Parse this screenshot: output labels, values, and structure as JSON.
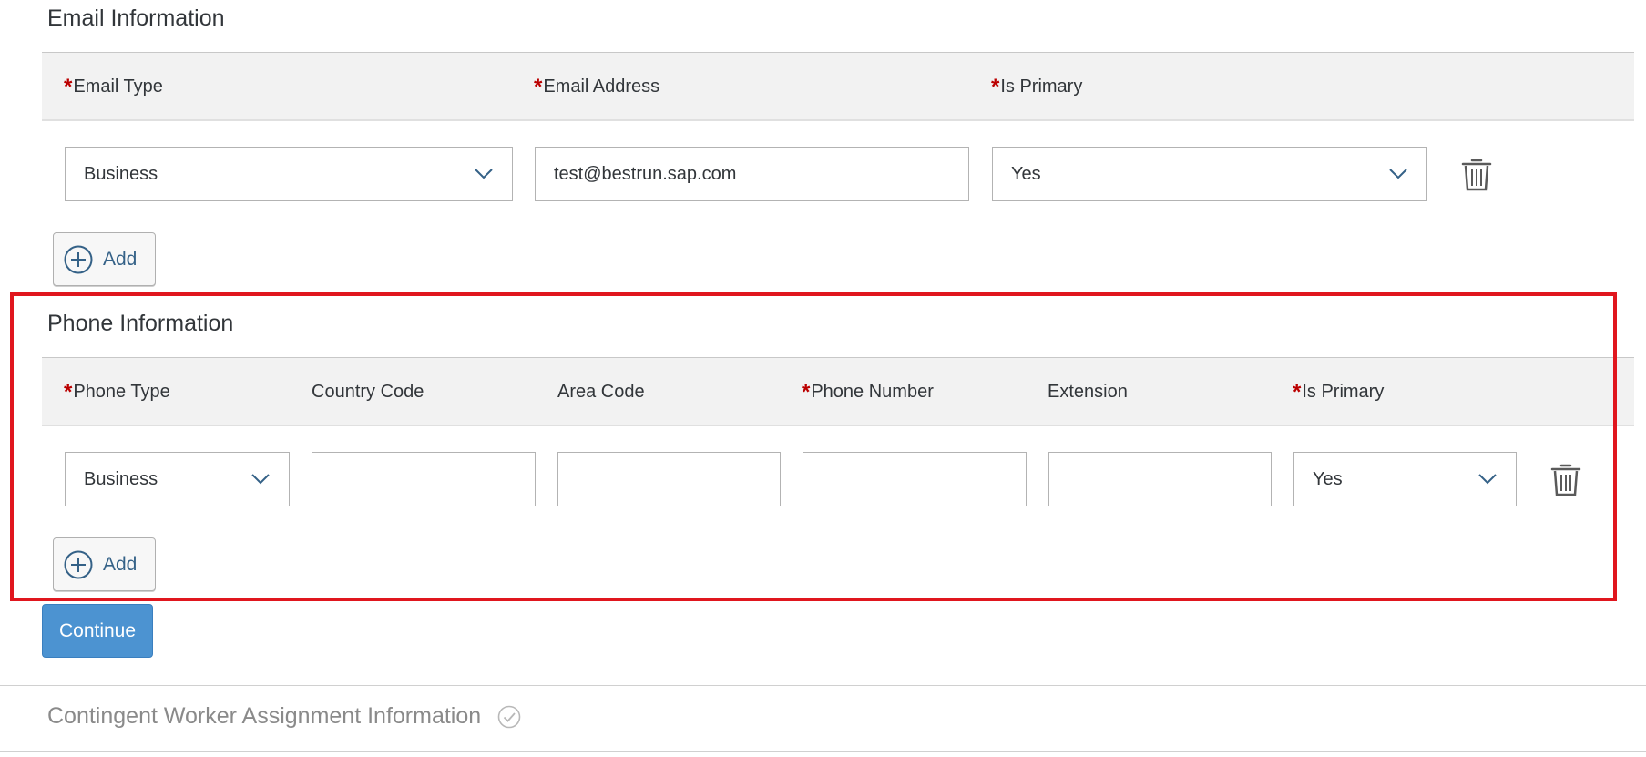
{
  "email_section": {
    "title": "Email Information",
    "columns": [
      {
        "label": "Email Type",
        "required": true
      },
      {
        "label": "Email Address",
        "required": true
      },
      {
        "label": "Is Primary",
        "required": true
      }
    ],
    "row": {
      "email_type": "Business",
      "email_address": "test@bestrun.sap.com",
      "is_primary": "Yes"
    },
    "add_label": "Add"
  },
  "phone_section": {
    "title": "Phone Information",
    "columns": [
      {
        "label": "Phone Type",
        "required": true
      },
      {
        "label": "Country Code",
        "required": false
      },
      {
        "label": "Area Code",
        "required": false
      },
      {
        "label": "Phone Number",
        "required": true
      },
      {
        "label": "Extension",
        "required": false
      },
      {
        "label": "Is Primary",
        "required": true
      }
    ],
    "row": {
      "phone_type": "Business",
      "country_code": "",
      "area_code": "",
      "phone_number": "",
      "extension": "",
      "is_primary": "Yes"
    },
    "add_label": "Add"
  },
  "continue_label": "Continue",
  "next_section": {
    "title": "Contingent Worker Assignment Information",
    "status_icon": "check-circle-icon"
  },
  "required_marker": "*",
  "colors": {
    "required": "#bb0000",
    "primary_button": "#4c93d1",
    "link": "#346187",
    "highlight": "#e0161e"
  }
}
